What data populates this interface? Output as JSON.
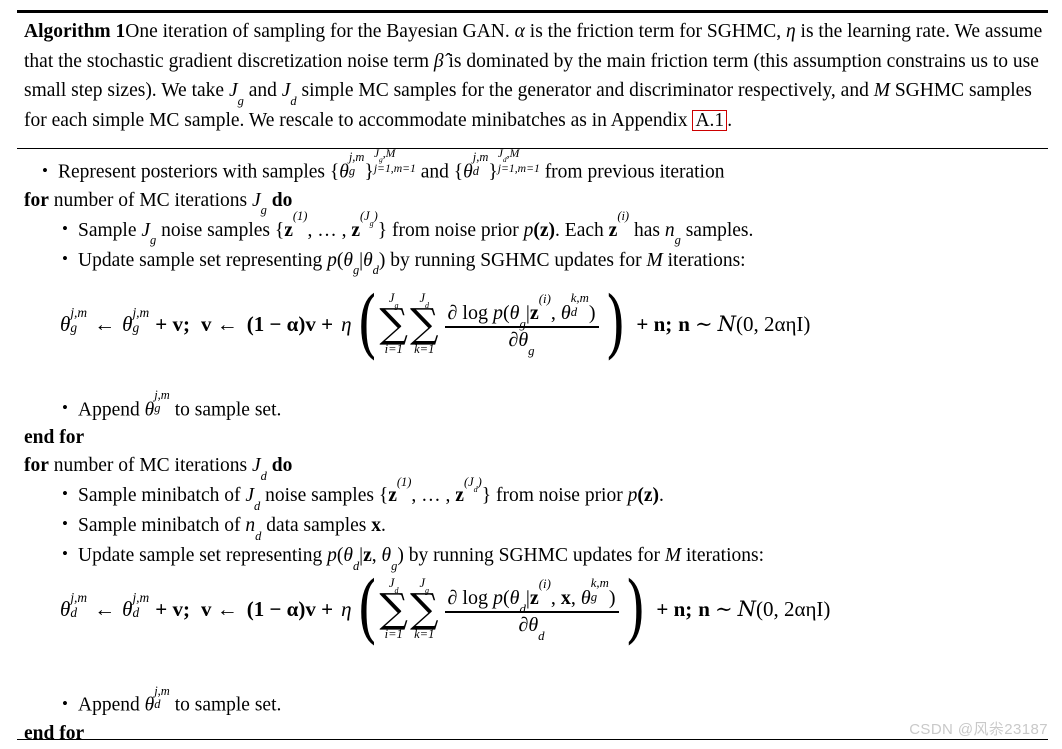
{
  "document": {
    "type": "algorithm-block",
    "algorithm_label": "Algorithm 1",
    "caption": {
      "title": "Algorithm 1",
      "line1_a": "One iteration of sampling for the Bayesian GAN. ",
      "alpha": "α",
      "line1_b": " is the friction term for SGHMC, ",
      "eta": "η",
      "line1_c": " is the",
      "line2_a": "learning rate. We assume that the stochastic gradient discretization noise term ",
      "beta_hat": "β̂",
      "line2_b": " is dominated by the main",
      "line3_a": "friction term (this assumption constrains us to use small step sizes). We take ",
      "Jg": "J",
      "Jg_sub": "g",
      "line3_b": " and ",
      "Jd": "J",
      "Jd_sub": "d",
      "line3_c": " simple MC samples for",
      "line4_a": "the generator and discriminator respectively, and ",
      "M": "M",
      "line4_b": " SGHMC samples for each simple MC sample. We rescale",
      "line5_a": "to accommodate minibatches as in Appendix ",
      "appendix_link": "A.1",
      "line5_b": "."
    },
    "body": {
      "represent": {
        "text_a": "Represent posteriors with samples ",
        "theta_g": "θ",
        "sub_g": "g",
        "sup_jm": "j,m",
        "limits_up_g": "J",
        "limits_up_g_sub": "g",
        "limits_up_M": ",M",
        "limits_dn": "j=1,m=1",
        "text_b": " and ",
        "theta_d": "θ",
        "sub_d": "d",
        "limits_up_d": "J",
        "limits_up_d_sub": "d",
        "text_c": " from previous iteration"
      },
      "for_g": {
        "kw_for": "for",
        "text": " number of MC iterations ",
        "var": "J",
        "var_sub": "g",
        "kw_do": "do"
      },
      "sample_noise_g": {
        "text_a": "Sample ",
        "J": "J",
        "J_sub": "g",
        "text_b": " noise samples {",
        "z": "z",
        "z_sup1": "(1)",
        "text_c": ", … , ",
        "z2": "z",
        "z_sup2": "(J",
        "z_sup2_sub": "g",
        "z_sup2_end": ")",
        "text_d": "} from noise prior ",
        "p": "p",
        "pz": "(z)",
        "text_e": ". Each ",
        "z3": "z",
        "z3_sup": "(i)",
        "text_f": " has ",
        "n": "n",
        "n_sub": "g",
        "text_g": " samples."
      },
      "update_g": {
        "text_a": "Update sample set representing ",
        "p": "p",
        "paren_open": "(",
        "theta_g": "θ",
        "sub_g": "g",
        "mid": "|",
        "theta_d": "θ",
        "sub_d": "d",
        "paren_close": ")",
        "text_b": " by running SGHMC updates for ",
        "M": "M",
        "text_c": " iterations:"
      },
      "append_g": {
        "text_a": "Append ",
        "theta": "θ",
        "sub": "g",
        "sup": "j,m",
        "text_b": " to sample set."
      },
      "end_for_g": "end for",
      "for_d": {
        "kw_for": "for",
        "text": " number of MC iterations ",
        "var": "J",
        "var_sub": "d",
        "kw_do": "do"
      },
      "sample_noise_d": {
        "text_a": "Sample minibatch of ",
        "J": "J",
        "J_sub": "d",
        "text_b": " noise samples {",
        "z": "z",
        "z_sup1": "(1)",
        "text_c": ", … , ",
        "z2": "z",
        "z_sup2": "(J",
        "z_sup2_sub": "d",
        "z_sup2_end": ")",
        "text_d": "} from noise prior ",
        "p": "p",
        "pz": "(z)",
        "text_e": "."
      },
      "sample_data_d": {
        "text_a": "Sample minibatch of ",
        "n": "n",
        "n_sub": "d",
        "text_b": " data samples ",
        "x": "x",
        "text_c": "."
      },
      "update_d": {
        "text_a": "Update sample set representing ",
        "p": "p",
        "paren_open": "(",
        "theta_d": "θ",
        "sub_d": "d",
        "mid": "|",
        "z": "z",
        "comma": ", ",
        "theta_g": "θ",
        "sub_g": "g",
        "paren_close": ")",
        "text_b": " by running SGHMC updates for ",
        "M": "M",
        "text_c": " iterations:"
      },
      "append_d": {
        "text_a": "Append ",
        "theta": "θ",
        "sub": "d",
        "sup": "j,m",
        "text_b": " to sample set."
      },
      "end_for_d": "end for"
    },
    "equations": {
      "generator": {
        "theta": "θ",
        "theta_sub": "g",
        "theta_sup": "j,m",
        "arrow": "←",
        "plus_v": "+ v;",
        "v_arrow": "v ←",
        "one_minus_alpha": "(1 − α)v +",
        "eta": "η",
        "sum1_up": "J",
        "sum1_up_sub": "g",
        "sum1_dn": "i=1",
        "sum2_up": "J",
        "sum2_up_sub": "d",
        "sum2_dn": "k=1",
        "num_partial": "∂",
        "num_log": " log ",
        "num_p": "p",
        "num_open": "(",
        "num_theta": "θ",
        "num_theta_sub": "g",
        "num_mid": "|",
        "num_z": "z",
        "num_z_sup": "(i)",
        "num_comma": ", ",
        "num_theta2": "θ",
        "num_theta2_sub": "d",
        "num_theta2_sup": "k,m",
        "num_close": ")",
        "den_partial": "∂",
        "den_theta": "θ",
        "den_theta_sub": "g",
        "tail_plus_n": "+ n;",
        "tail_n": "n",
        "tail_sim": "∼",
        "tail_cal": "Ν",
        "tail_args": "(0, 2αηI)"
      },
      "discriminator": {
        "theta": "θ",
        "theta_sub": "d",
        "theta_sup": "j,m",
        "arrow": "←",
        "plus_v": "+ v;",
        "v_arrow": "v ←",
        "one_minus_alpha": "(1 − α)v +",
        "eta": "η",
        "sum1_up": "J",
        "sum1_up_sub": "d",
        "sum1_dn": "i=1",
        "sum2_up": "J",
        "sum2_up_sub": "g",
        "sum2_dn": "k=1",
        "num_partial": "∂",
        "num_log": " log ",
        "num_p": "p",
        "num_open": "(",
        "num_theta": "θ",
        "num_theta_sub": "d",
        "num_mid": "|",
        "num_z": "z",
        "num_z_sup": "(i)",
        "num_comma": ", ",
        "num_x": "x",
        "num_comma2": ", ",
        "num_theta2": "θ",
        "num_theta2_sub": "g",
        "num_theta2_sup": "k,m",
        "num_close": ")",
        "den_partial": "∂",
        "den_theta": "θ",
        "den_theta_sub": "d",
        "tail_plus_n": "+ n;",
        "tail_n": "n",
        "tail_sim": "∼",
        "tail_cal": "Ν",
        "tail_args": "(0, 2αηI)"
      }
    },
    "watermark": "CSDN @风尜23187",
    "colors": {
      "link_box": "#cc0000",
      "text": "#000000",
      "watermark": "#c9c9c9",
      "background": "#ffffff"
    }
  }
}
